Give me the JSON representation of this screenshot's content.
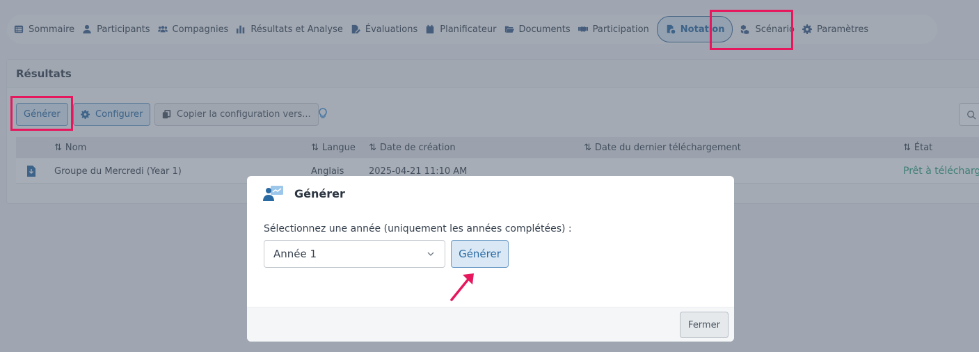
{
  "nav": {
    "items": [
      {
        "label": "Sommaire",
        "icon": "list-icon"
      },
      {
        "label": "Participants",
        "icon": "user-icon"
      },
      {
        "label": "Compagnies",
        "icon": "users-icon"
      },
      {
        "label": "Résultats et Analyse",
        "icon": "bar-chart-icon"
      },
      {
        "label": "Évaluations",
        "icon": "file-edit-icon"
      },
      {
        "label": "Planificateur",
        "icon": "calendar-icon"
      },
      {
        "label": "Documents",
        "icon": "folder-open-icon"
      },
      {
        "label": "Participation",
        "icon": "handshake-icon"
      },
      {
        "label": "Notation",
        "icon": "file-badge-icon",
        "active": true
      },
      {
        "label": "Scénario",
        "icon": "cubes-icon"
      },
      {
        "label": "Paramètres",
        "icon": "gear-icon"
      }
    ]
  },
  "panel": {
    "title": "Résultats",
    "buttons": {
      "generate": "Générer",
      "configure": "Configurer",
      "copy_config": "Copier la configuration vers..."
    }
  },
  "table": {
    "columns": [
      "Nom",
      "Langue",
      "Date de création",
      "Date du dernier téléchargement",
      "État"
    ],
    "rows": [
      {
        "name": "Groupe du Mercredi (Year 1)",
        "language": "Anglais",
        "created": "2025-04-21 11:10 AM",
        "last_download": "",
        "status": "Prêt à télécharg"
      }
    ]
  },
  "modal": {
    "title": "Générer",
    "label": "Sélectionnez une année (uniquement les années complétées) :",
    "select_value": "Année 1",
    "generate_button": "Générer",
    "close_button": "Fermer"
  },
  "colors": {
    "accent": "#2a6aa3",
    "highlight": "#e6175c",
    "status_ready": "#2aa17a"
  }
}
